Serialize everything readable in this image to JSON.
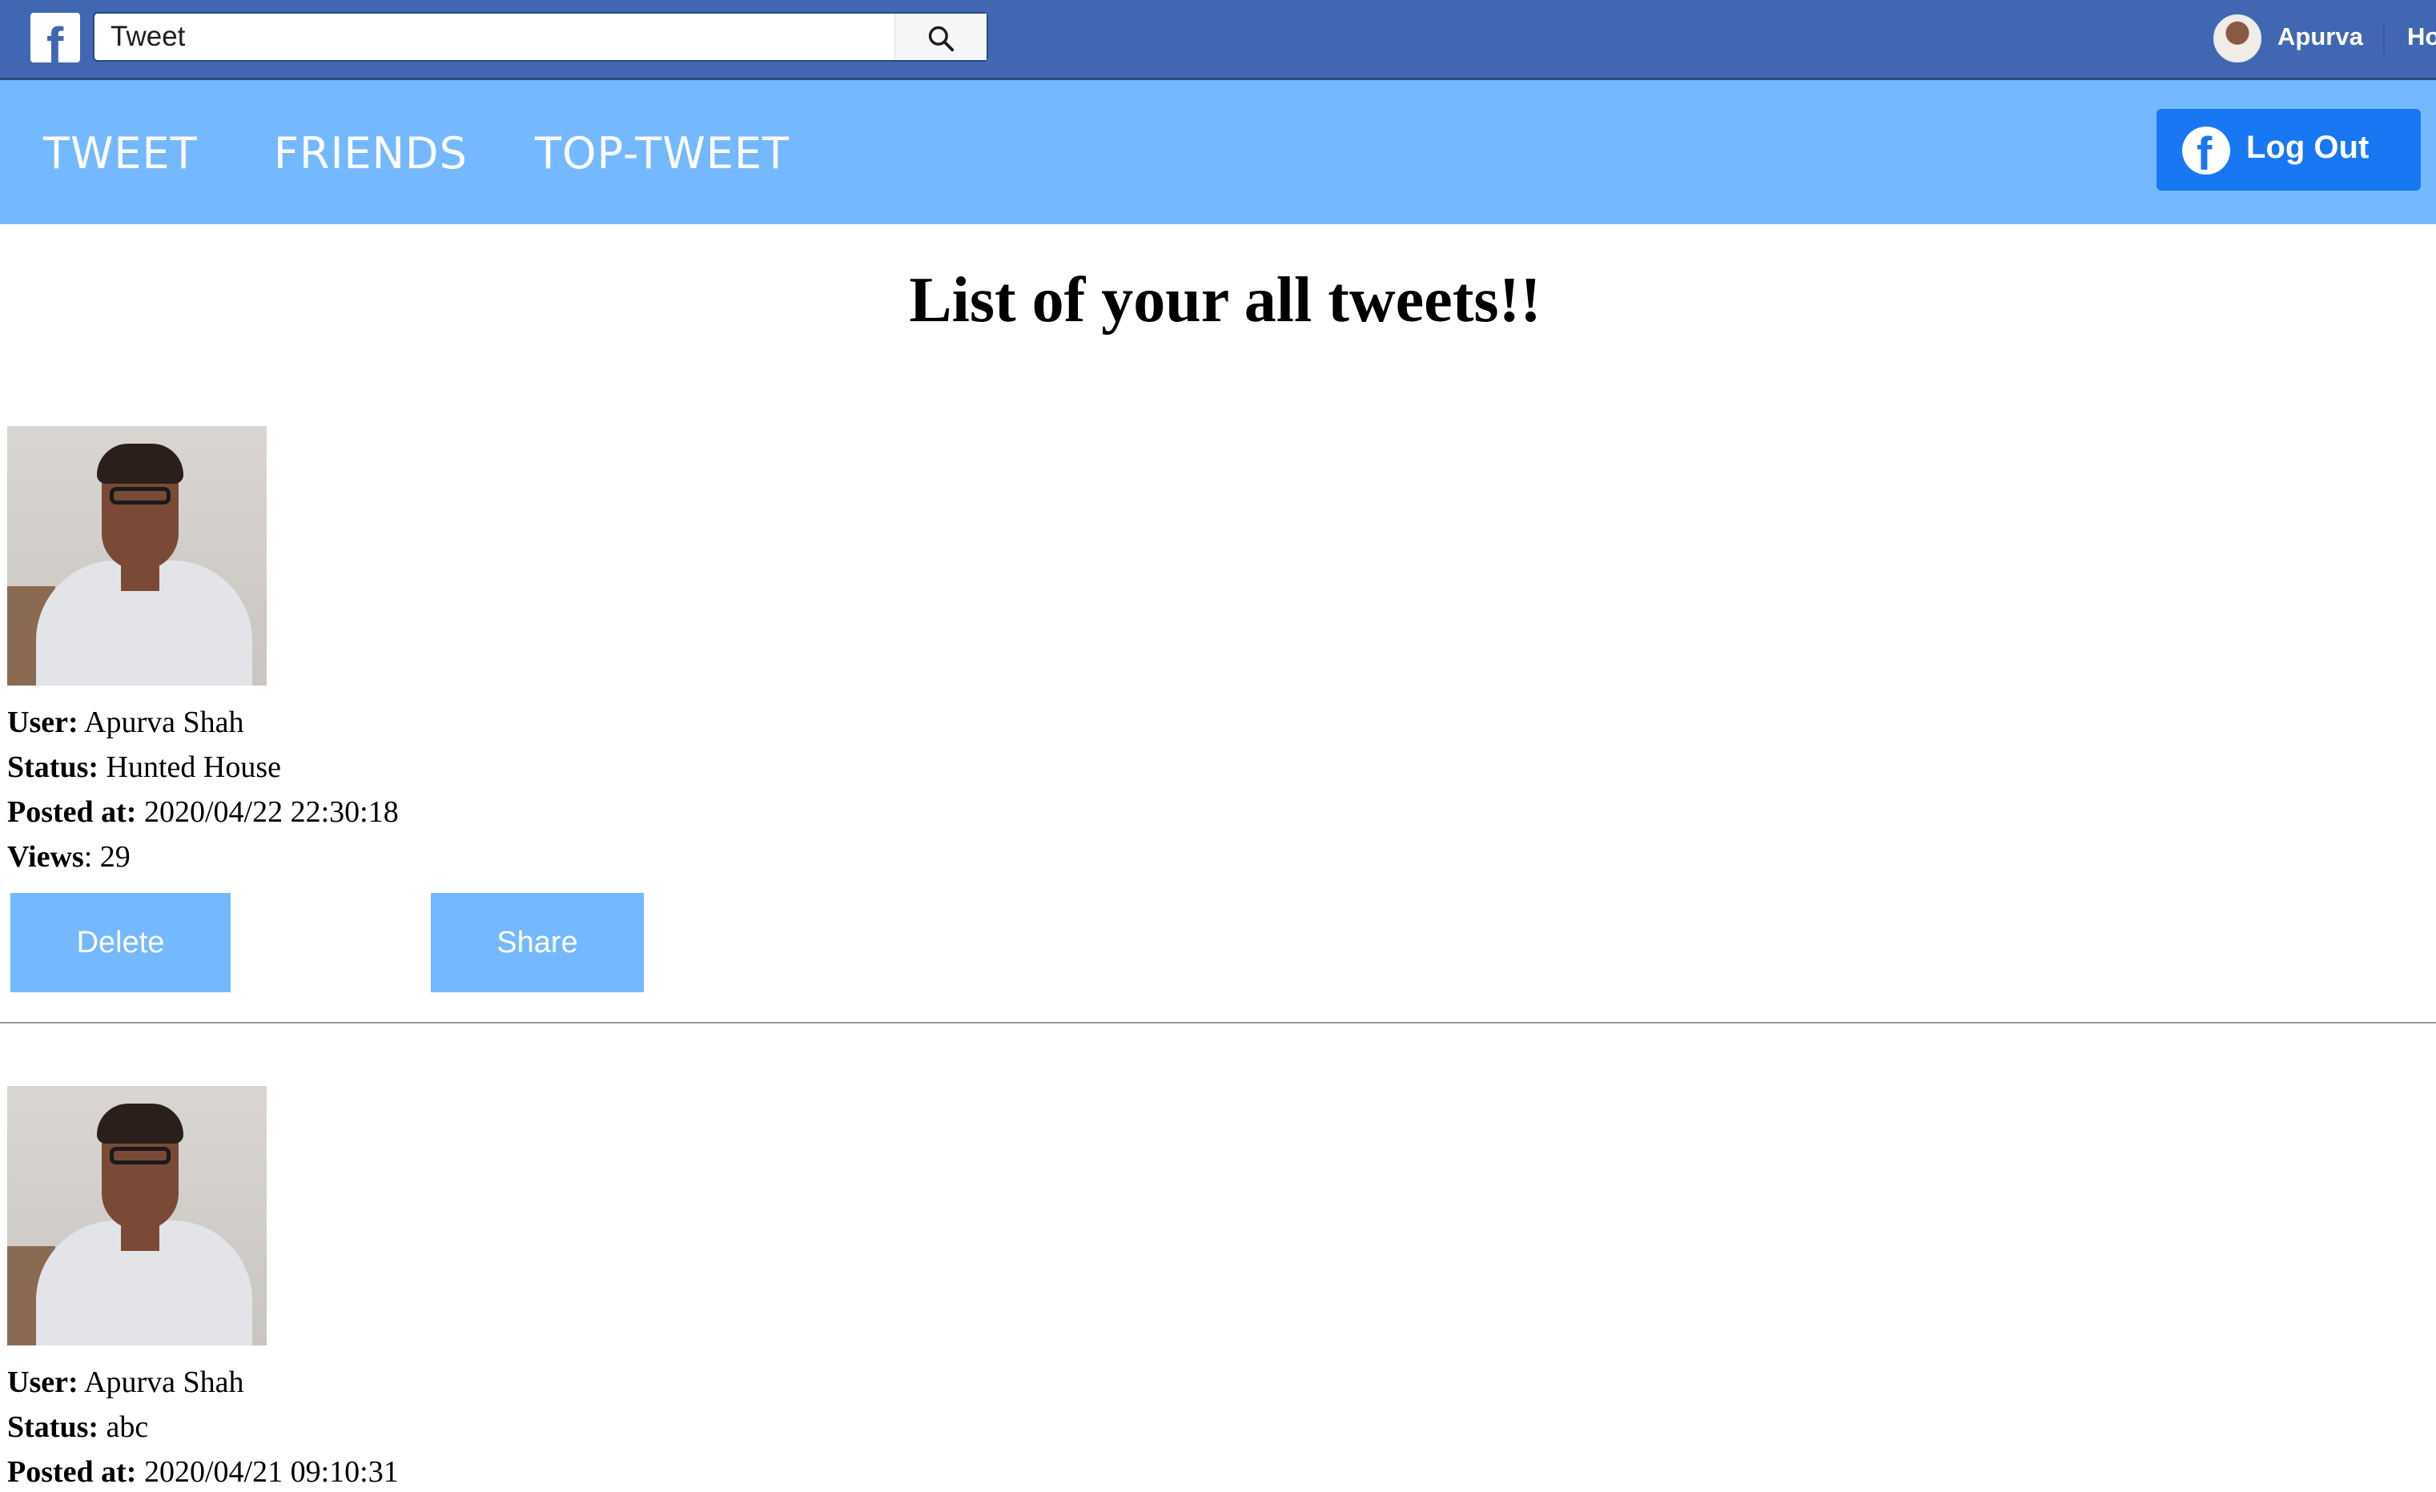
{
  "fb_bar": {
    "search_value": "Tweet",
    "user_name": "Apurva",
    "home_label": "Ho"
  },
  "nav": {
    "items": [
      {
        "label": "TWEET"
      },
      {
        "label": "FRIENDS"
      },
      {
        "label": "TOP-TWEET"
      }
    ],
    "logout_label": "Log Out"
  },
  "page_title": "List of your all tweets!!",
  "labels": {
    "user": "User:",
    "status": "Status:",
    "posted_at": "Posted at:",
    "views": "Views"
  },
  "tweets": [
    {
      "user": "Apurva Shah",
      "status": "Hunted House",
      "posted_at": "2020/04/22 22:30:18",
      "views": ": 29",
      "delete_label": "Delete",
      "share_label": "Share"
    },
    {
      "user": "Apurva Shah",
      "status": "abc",
      "posted_at": "2020/04/21 09:10:31"
    }
  ],
  "colors": {
    "fb_blue": "#4267b2",
    "nav_blue": "#74b9ff",
    "logout_blue": "#1877f2"
  },
  "icons": {
    "fb_logo": "facebook-logo-icon",
    "search": "search-icon",
    "logout": "facebook-circle-icon"
  }
}
